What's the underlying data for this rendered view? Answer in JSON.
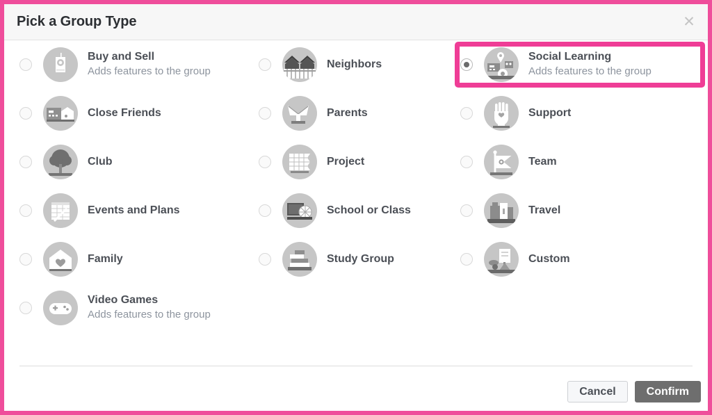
{
  "colors": {
    "highlight_pink": "#ef3d96",
    "frame_pink": "#ef4e9b",
    "confirm_button_bg": "#6e6e6e",
    "cancel_button_bg": "#f6f7f9",
    "icon_circle_bg": "#c6c6c6",
    "title_text": "#2c2f33",
    "option_title_text": "#4b4f56",
    "option_sub_text": "#8d949e"
  },
  "header": {
    "title": "Pick a Group Type",
    "close_icon": "close-icon",
    "close_glyph": "✕"
  },
  "columns": [
    {
      "options": [
        {
          "title": "Buy and Sell",
          "subtitle": "Adds features to the group",
          "icon": "price-tag-icon",
          "selected": false,
          "highlighted": false
        },
        {
          "title": "Close Friends",
          "subtitle": "",
          "icon": "friends-icon",
          "selected": false,
          "highlighted": false
        },
        {
          "title": "Club",
          "subtitle": "",
          "icon": "tree-icon",
          "selected": false,
          "highlighted": false
        },
        {
          "title": "Events and Plans",
          "subtitle": "",
          "icon": "calendar-icon",
          "selected": false,
          "highlighted": false
        },
        {
          "title": "Family",
          "subtitle": "",
          "icon": "home-heart-icon",
          "selected": false,
          "highlighted": false
        },
        {
          "title": "Video Games",
          "subtitle": "Adds features to the group",
          "icon": "gamepad-icon",
          "selected": false,
          "highlighted": false
        }
      ]
    },
    {
      "options": [
        {
          "title": "Neighbors",
          "subtitle": "",
          "icon": "houses-fence-icon",
          "selected": false,
          "highlighted": false
        },
        {
          "title": "Parents",
          "subtitle": "",
          "icon": "stroller-icon",
          "selected": false,
          "highlighted": false
        },
        {
          "title": "Project",
          "subtitle": "",
          "icon": "blueprint-icon",
          "selected": false,
          "highlighted": false
        },
        {
          "title": "School or Class",
          "subtitle": "",
          "icon": "chalkboard-icon",
          "selected": false,
          "highlighted": false
        },
        {
          "title": "Study Group",
          "subtitle": "",
          "icon": "books-icon",
          "selected": false,
          "highlighted": false
        }
      ]
    },
    {
      "options": [
        {
          "title": "Social Learning",
          "subtitle": "Adds features to the group",
          "icon": "social-learning-icon",
          "selected": true,
          "highlighted": true
        },
        {
          "title": "Support",
          "subtitle": "",
          "icon": "hand-heart-icon",
          "selected": false,
          "highlighted": false
        },
        {
          "title": "Team",
          "subtitle": "",
          "icon": "pennant-flag-icon",
          "selected": false,
          "highlighted": false
        },
        {
          "title": "Travel",
          "subtitle": "",
          "icon": "suitcase-icon",
          "selected": false,
          "highlighted": false
        },
        {
          "title": "Custom",
          "subtitle": "",
          "icon": "easel-icon",
          "selected": false,
          "highlighted": false
        }
      ]
    }
  ],
  "footer": {
    "cancel_label": "Cancel",
    "confirm_label": "Confirm"
  }
}
